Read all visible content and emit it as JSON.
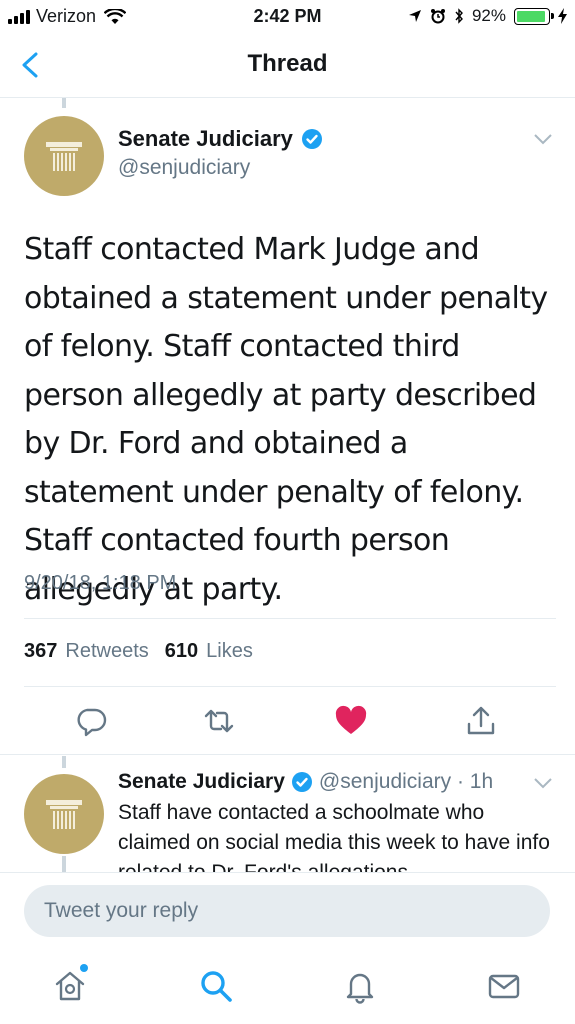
{
  "status_bar": {
    "carrier": "Verizon",
    "time": "2:42 PM",
    "battery": "92%",
    "battery_level": 0.92
  },
  "nav": {
    "title": "Thread",
    "back_icon": "chevron-left-icon"
  },
  "main_tweet": {
    "name": "Senate Judiciary",
    "handle": "@senjudiciary",
    "text": "Staff contacted Mark Judge and obtained a statement under penalty of felony. Staff contacted third person allegedly at party described by Dr. Ford and obtained a statement under penalty of felony. Staff contacted fourth person allegedly at party.",
    "timestamp": "9/20/18, 1:18 PM",
    "retweets_count": "367",
    "retweets_label": "Retweets",
    "likes_count": "610",
    "likes_label": "Likes",
    "liked": true
  },
  "reply_tweet": {
    "name": "Senate Judiciary",
    "meta": "@senjudiciary · 1h",
    "text": "Staff have contacted a schoolmate who claimed on social media this week to have info related to Dr. Ford's allegations"
  },
  "composer": {
    "placeholder": "Tweet your reply"
  },
  "colors": {
    "accent": "#1da1f2",
    "like": "#e0245e",
    "muted": "#657786",
    "avatar": "#bfaa6a"
  },
  "tabs": [
    "home-icon",
    "search-icon",
    "notifications-icon",
    "messages-icon"
  ]
}
